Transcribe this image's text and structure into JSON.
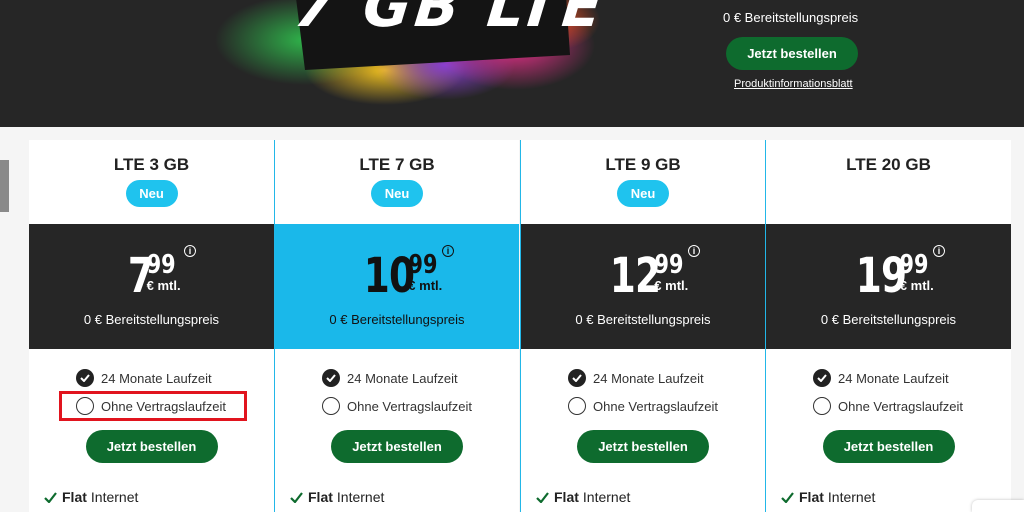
{
  "hero": {
    "title": "7 GB LTE",
    "fee": "0 € Bereitstellungspreis",
    "order_label": "Jetzt bestellen",
    "info_link": "Produktinformationsblatt"
  },
  "colors": {
    "accent_green": "#0e6b2e",
    "accent_blue": "#1ab8ea",
    "dark": "#262626",
    "highlight_red": "#e1141e"
  },
  "plans": [
    {
      "name": "LTE 3 GB",
      "badge": "Neu",
      "price_int": "7",
      "price_cents": "99",
      "price_unit": "€ mtl.",
      "info": "i",
      "fee": "0 € Bereitstellungspreis",
      "option1": "24 Monate Laufzeit",
      "option2": "Ohne Vertragslaufzeit",
      "order_label": "Jetzt bestellen",
      "feature_bold": "Flat",
      "feature_text": "Internet"
    },
    {
      "name": "LTE 7 GB",
      "badge": "Neu",
      "price_int": "10",
      "price_cents": "99",
      "price_unit": "€ mtl.",
      "info": "i",
      "fee": "0 € Bereitstellungspreis",
      "option1": "24 Monate Laufzeit",
      "option2": "Ohne Vertragslaufzeit",
      "order_label": "Jetzt bestellen",
      "feature_bold": "Flat",
      "feature_text": "Internet"
    },
    {
      "name": "LTE 9 GB",
      "badge": "Neu",
      "price_int": "12",
      "price_cents": "99",
      "price_unit": "€ mtl.",
      "info": "i",
      "fee": "0 € Bereitstellungspreis",
      "option1": "24 Monate Laufzeit",
      "option2": "Ohne Vertragslaufzeit",
      "order_label": "Jetzt bestellen",
      "feature_bold": "Flat",
      "feature_text": "Internet"
    },
    {
      "name": "LTE 20 GB",
      "price_int": "19",
      "price_cents": "99",
      "price_unit": "€ mtl.",
      "info": "i",
      "fee": "0 € Bereitstellungspreis",
      "option1": "24 Monate Laufzeit",
      "option2": "Ohne Vertragslaufzeit",
      "order_label": "Jetzt bestellen",
      "feature_bold": "Flat",
      "feature_text": "Internet"
    }
  ]
}
